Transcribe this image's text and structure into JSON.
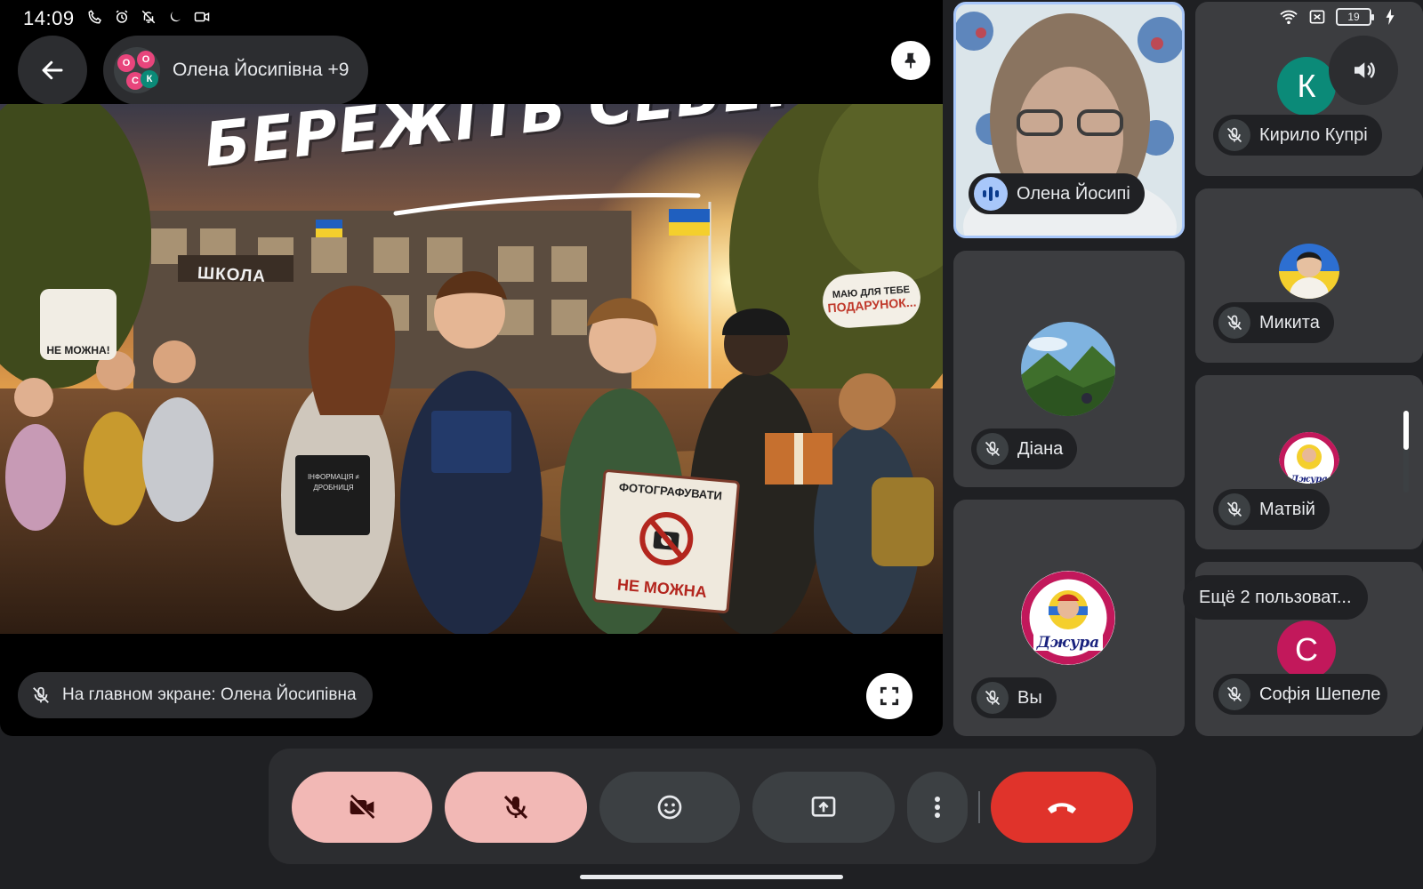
{
  "status_bar": {
    "time": "14:09",
    "left_icons": [
      "phone-call-icon",
      "alarm-icon",
      "bell-off-icon",
      "moon-icon",
      "video-icon"
    ],
    "right_icons": [
      "wifi-icon",
      "no-sim-icon",
      "battery-icon"
    ],
    "battery_level": "19"
  },
  "header": {
    "caller_name": "Олена Йосипівна +9",
    "avatar_letters": [
      "О",
      "О",
      "С",
      "К"
    ]
  },
  "shared_screen": {
    "headline": "БЕРЕЖІТЬ СЕБЕ!",
    "school_label": "ШКОЛА",
    "bubble_left": "НЕ МОЖНА!",
    "bubble_right_line1": "МАЮ ДЛЯ ТЕБЕ",
    "bubble_right_line2": "ПОДАРУНОК...",
    "book_text": "ІНФОРМАЦІЯ ≠ ДРОБНИЦЯ",
    "sign_top": "ФОТОГРАФУВАТИ",
    "sign_bottom": "НЕ МОЖНА",
    "main_screen_label": "На главном экране: Олена Йосипівна"
  },
  "participants": [
    {
      "name": "Олена Йосипі",
      "state": "speaking",
      "type": "video"
    },
    {
      "name": "Кирило Купрі",
      "state": "muted",
      "avatar_letter": "К",
      "avatar_color": "#0b8a78"
    },
    {
      "name": "Діана",
      "state": "muted",
      "type": "photo-landscape"
    },
    {
      "name": "Микита",
      "state": "muted",
      "type": "photo-boy"
    },
    {
      "name": "Вы",
      "state": "muted",
      "type": "logo"
    },
    {
      "name": "Матвій",
      "state": "muted",
      "type": "logo"
    },
    {
      "name": "Софія Шепеле",
      "state": "muted",
      "avatar_letter": "С",
      "avatar_color": "#c2185b"
    }
  ],
  "logo_text": "Джура",
  "more_participants": "Ещё 2 пользоват...",
  "controls": [
    "camera-off-icon",
    "mic-off-icon",
    "emoji-icon",
    "present-screen-icon",
    "more-vertical-icon",
    "end-call-icon"
  ],
  "colors": {
    "background": "#1f2023",
    "tile": "#3c3d40",
    "chip": "#202124",
    "muted_control": "#f2b8b5",
    "end_call": "#e0332b",
    "speaking": "#a8c7fa"
  }
}
